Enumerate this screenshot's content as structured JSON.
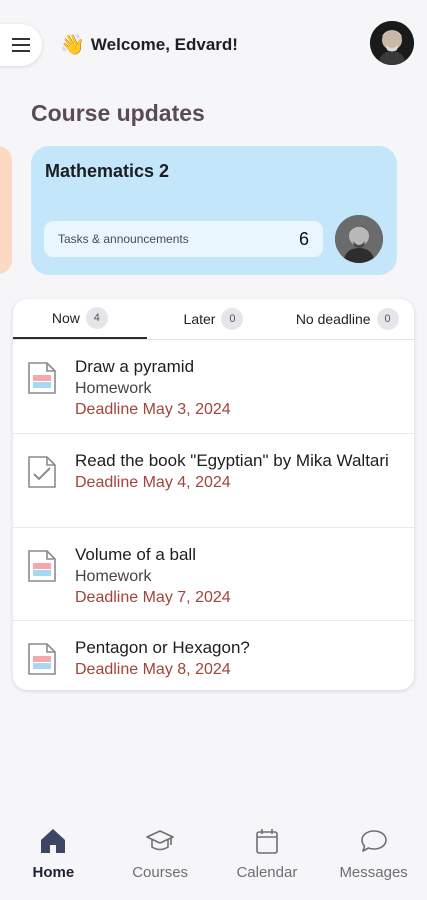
{
  "header": {
    "welcome_emoji": "👋",
    "welcome_text": "Welcome, Edvard!"
  },
  "section_title": "Course updates",
  "course_card": {
    "name": "Mathematics 2",
    "tasks_label": "Tasks & announcements",
    "tasks_count": "6",
    "color": "#c3e6fb"
  },
  "tabs": [
    {
      "label": "Now",
      "count": "4",
      "active": true
    },
    {
      "label": "Later",
      "count": "0",
      "active": false
    },
    {
      "label": "No deadline",
      "count": "0",
      "active": false
    }
  ],
  "tasks": [
    {
      "title": "Draw a pyramid",
      "type": "Homework",
      "deadline": "Deadline May 3, 2024",
      "icon": "assignment-doc-icon"
    },
    {
      "title": "Read the book \"Egyptian\" by Mika Waltari",
      "type": "",
      "deadline": "Deadline May 4, 2024",
      "icon": "checklist-doc-icon"
    },
    {
      "title": "Volume of a ball",
      "type": "Homework",
      "deadline": "Deadline May 7, 2024",
      "icon": "assignment-doc-icon"
    },
    {
      "title": "Pentagon or Hexagon?",
      "type": "",
      "deadline": "Deadline May 8, 2024",
      "icon": "assignment-doc-icon"
    }
  ],
  "bottom_nav": [
    {
      "label": "Home",
      "icon": "home-icon",
      "active": true
    },
    {
      "label": "Courses",
      "icon": "graduation-cap-icon",
      "active": false
    },
    {
      "label": "Calendar",
      "icon": "calendar-icon",
      "active": false
    },
    {
      "label": "Messages",
      "icon": "chat-bubble-icon",
      "active": false
    }
  ],
  "colors": {
    "deadline": "#a1443a",
    "section_title": "#5d4a58",
    "peek_card": "#fcd9c3"
  }
}
